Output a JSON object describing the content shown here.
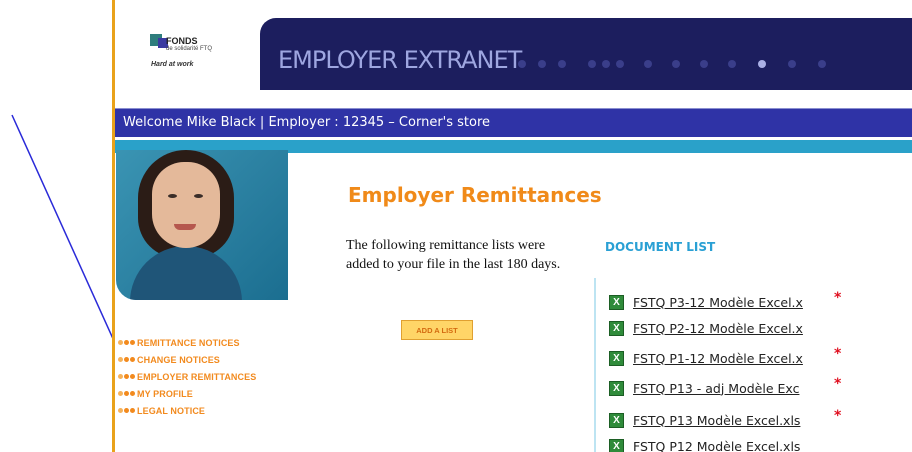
{
  "header": {
    "logo_name": "FONDS",
    "logo_sub": "de solidarité FTQ",
    "logo_tagline": "Hard at work",
    "banner_title": "EMPLOYER EXTRANET"
  },
  "welcome_bar": {
    "text": "Welcome Mike Black |  Employer : 12345 – Corner's store"
  },
  "nav": {
    "items": [
      {
        "label": "REMITTANCE NOTICES"
      },
      {
        "label": "CHANGE NOTICES"
      },
      {
        "label": "EMPLOYER REMITTANCES"
      },
      {
        "label": "MY PROFILE"
      },
      {
        "label": "LEGAL NOTICE"
      }
    ]
  },
  "main": {
    "title": "Employer Remittances",
    "intro": "The following remittance lists were added to your file in the last 180 days.",
    "add_button": "ADD A LIST"
  },
  "documents": {
    "heading": "DOCUMENT LIST",
    "icon": "excel-file-icon",
    "items": [
      {
        "name": "FSTQ P3-12 Modèle Excel.x",
        "new": "*"
      },
      {
        "name": "FSTQ P2-12 Modèle Excel.x",
        "new": ""
      },
      {
        "name": "FSTQ P1-12 Modèle Excel.x",
        "new": "*"
      },
      {
        "name": "FSTQ P13 - adj Modèle Exc",
        "new": "*"
      },
      {
        "name": "FSTQ P13 Modèle Excel.xls",
        "new": "*"
      },
      {
        "name": "FSTQ P12 Modèle Excel.xls",
        "new": ""
      }
    ]
  },
  "colors": {
    "banner": "#1c1e5e",
    "welcome_bar": "#2f33a6",
    "accent": "#f08a19",
    "link_blue": "#2aa0d4",
    "arrow": "#2a2ad8"
  }
}
